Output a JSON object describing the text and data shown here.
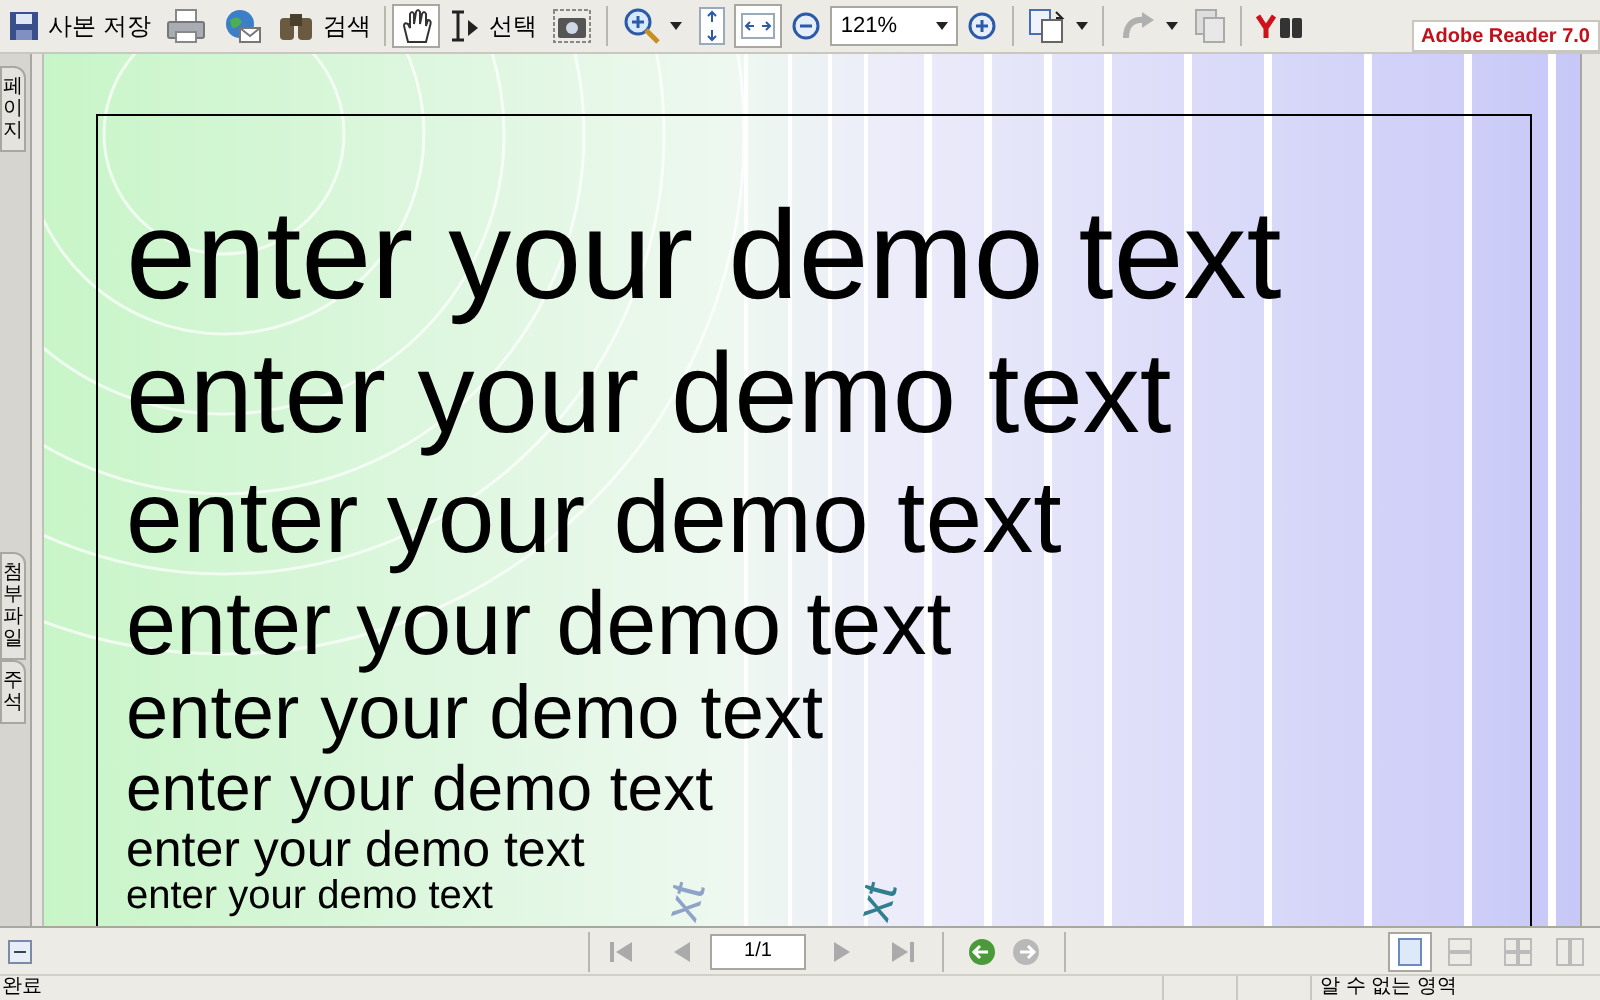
{
  "toolbar": {
    "save_label": "사본 저장",
    "search_label": "검색",
    "select_label": "선택",
    "hand_selected": true,
    "fit_width_selected": true,
    "zoom_value": "121%",
    "brand": "Adobe Reader 7.0"
  },
  "side_tabs": [
    {
      "label": "페이지"
    },
    {
      "label": "첨부 파일"
    },
    {
      "label": "주석"
    }
  ],
  "document": {
    "lines": [
      "enter your demo text",
      "enter your demo text",
      "enter your demo text",
      "enter your demo text",
      "enter your demo text",
      "enter your demo text",
      "enter your demo text",
      "enter your demo text"
    ],
    "rotated_fragments": [
      {
        "text": "xt",
        "color": "#8fa3c8"
      },
      {
        "text": "xt",
        "color": "#2f7f8f"
      }
    ]
  },
  "nav": {
    "page": "1/1"
  },
  "status_bar": {
    "left": "완료",
    "right": "알 수 없는 영역"
  }
}
